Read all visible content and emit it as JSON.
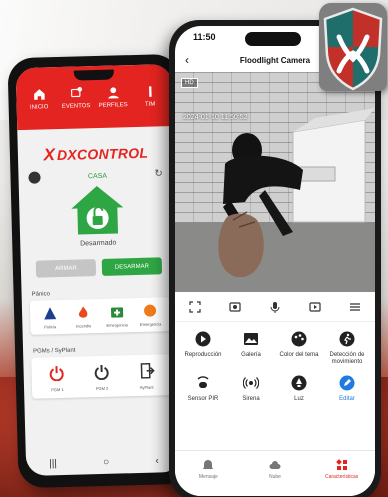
{
  "android": {
    "nav": [
      {
        "label": "INICIO",
        "icon": "home-icon"
      },
      {
        "label": "EVENTOS",
        "icon": "bell-icon"
      },
      {
        "label": "PERFILES",
        "icon": "user-icon"
      },
      {
        "label": "TIM",
        "icon": "more-icon"
      }
    ],
    "brand": {
      "mark": "X",
      "name": "DXCONTROL"
    },
    "partition": "CASA",
    "status": "Desarmado",
    "buttons": {
      "arm": "ARMAR",
      "disarm": "DESARMAR"
    },
    "panic_section": "Pánico",
    "panic": [
      {
        "label": "Policía"
      },
      {
        "label": "Incendio"
      },
      {
        "label": "Emergencia"
      },
      {
        "label": "Emergencia"
      }
    ],
    "pgm_section": "PGMs / SyPlant",
    "pgm": [
      {
        "label": "PGM 1"
      },
      {
        "label": "PGM 2"
      },
      {
        "label": "SyPlant"
      }
    ]
  },
  "iphone": {
    "time": "11:50",
    "title": "Floodlight Camera",
    "hd_label": "HD",
    "timestamp": "2024-01-10 11:50:52",
    "features": [
      {
        "label": "Reproducción",
        "icon": "play-icon"
      },
      {
        "label": "Galería",
        "icon": "gallery-icon"
      },
      {
        "label": "Color del tema",
        "icon": "palette-icon"
      },
      {
        "label": "Detección de movimiento",
        "icon": "motion-icon"
      },
      {
        "label": "Sensor PIR",
        "icon": "pir-icon"
      },
      {
        "label": "Sirena",
        "icon": "siren-icon"
      },
      {
        "label": "Luz",
        "icon": "light-icon"
      },
      {
        "label": "Editar",
        "icon": "edit-icon"
      }
    ],
    "tabs": [
      {
        "label": "Mensaje",
        "icon": "message-icon"
      },
      {
        "label": "Nube",
        "icon": "cloud-icon"
      },
      {
        "label": "Características",
        "icon": "features-icon"
      }
    ]
  },
  "colors": {
    "brand_red": "#e32420",
    "green": "#2fa644",
    "edit_blue": "#1e7be0"
  }
}
